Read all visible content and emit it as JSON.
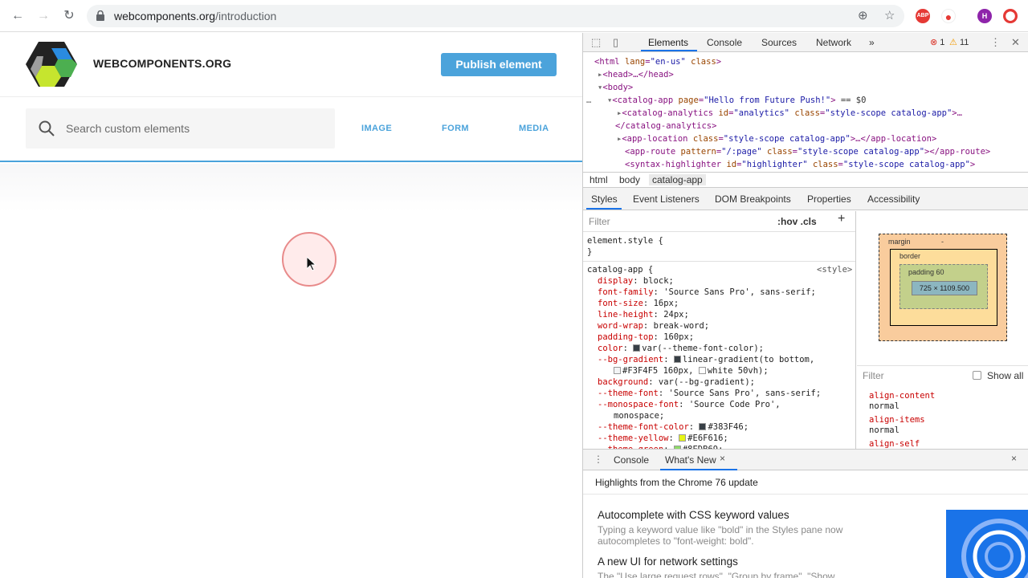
{
  "browser": {
    "url_domain": "webcomponents.org",
    "url_path": "/introduction",
    "profile_initial": "H"
  },
  "site": {
    "title": "WEBCOMPONENTS.ORG",
    "publish_label": "Publish element",
    "search_placeholder": "Search custom elements",
    "categories": [
      "IMAGE",
      "FORM",
      "MEDIA"
    ],
    "accent_color": "#4ba3db"
  },
  "devtools": {
    "tabs": [
      "Elements",
      "Console",
      "Sources",
      "Network"
    ],
    "more": "»",
    "error_count": "1",
    "warning_count": "11",
    "dom": {
      "l1_tag": "<html",
      "l1_attr1": "lang",
      "l1_val1": "\"en-us\"",
      "l1_attr2": "class",
      "l1_close": ">",
      "l2": "<head>…</head>",
      "l3": "<body>",
      "l4_prefix": "…",
      "l4_tag": "<catalog-app",
      "l4_attr": "page",
      "l4_val": "\"Hello from Future Push!\"",
      "l4_close": ">",
      "l4_eq": "== $0",
      "l5_tag": "<catalog-analytics",
      "l5_attr1": "id",
      "l5_val1": "\"analytics\"",
      "l5_attr2": "class",
      "l5_val2": "\"style-scope catalog-app\"",
      "l5_close": ">…",
      "l6": "</catalog-analytics>",
      "l7_tag": "<app-location",
      "l7_attr": "class",
      "l7_val": "\"style-scope catalog-app\"",
      "l7_close": ">…</app-location>",
      "l8_tag": "<app-route",
      "l8_attr1": "pattern",
      "l8_val1": "\"/:page\"",
      "l8_attr2": "class",
      "l8_val2": "\"style-scope catalog-app\"",
      "l8_close": "></app-route>",
      "l9_tag": "<syntax-highlighter",
      "l9_attr1": "id",
      "l9_val1": "\"highlighter\"",
      "l9_attr2": "class",
      "l9_val2": "\"style-scope catalog-app\"",
      "l9_close": ">"
    },
    "breadcrumbs": [
      "html",
      "body",
      "catalog-app"
    ],
    "sub_tabs": [
      "Styles",
      "Event Listeners",
      "DOM Breakpoints",
      "Properties",
      "Accessibility"
    ],
    "styles": {
      "filter_placeholder": "Filter",
      "hov_cls": ":hov .cls",
      "plus": "+",
      "element_style": "element.style {",
      "close_brace": "}",
      "selector": "catalog-app",
      "open_brace": "{",
      "source": "<style>",
      "props": [
        {
          "name": "display",
          "value": "block;"
        },
        {
          "name": "font-family",
          "value": "'Source Sans Pro', sans-serif;"
        },
        {
          "name": "font-size",
          "value": "16px;"
        },
        {
          "name": "line-height",
          "value": "24px;"
        },
        {
          "name": "word-wrap",
          "value": "break-word;"
        },
        {
          "name": "padding-top",
          "value": "160px;"
        },
        {
          "name": "color",
          "value": "var(--theme-font-color);"
        },
        {
          "name": "--bg-gradient",
          "value": "linear-gradient(to bottom,"
        },
        {
          "name": "",
          "value": "#F3F4F5 160px,"
        },
        {
          "name": "background",
          "value": "var(--bg-gradient);"
        },
        {
          "name": "--theme-font",
          "value": "'Source Sans Pro', sans-serif;"
        },
        {
          "name": "--monospace-font",
          "value": "'Source Code Pro',"
        },
        {
          "name": "",
          "value": "monospace;"
        },
        {
          "name": "--theme-font-color",
          "value": "#383F46;"
        },
        {
          "name": "--theme-yellow",
          "value": "#E6F616;"
        },
        {
          "name": "--theme-green",
          "value": "#8EDB69;"
        }
      ],
      "gradient_white": "white 50vh);"
    },
    "box_model": {
      "margin": "margin",
      "border": "border",
      "padding": "padding 60",
      "content": "725 × 1109.500",
      "dash": "-"
    },
    "computed": {
      "filter": "Filter",
      "show_all": "Show all",
      "props": [
        {
          "name": "align-content",
          "value": "normal"
        },
        {
          "name": "align-items",
          "value": "normal"
        },
        {
          "name": "align-self",
          "value": ""
        }
      ]
    },
    "drawer": {
      "tabs": [
        "Console",
        "What's New"
      ],
      "close": "×",
      "highlights": "Highlights from the Chrome 76 update",
      "item1_title": "Autocomplete with CSS keyword values",
      "item1_desc": "Typing a keyword value like \"bold\" in the Styles pane now autocompletes to \"font-weight: bold\".",
      "item2_title": "A new UI for network settings",
      "item2_desc": "The \"Use large request rows\", \"Group by frame\", \"Show"
    }
  }
}
